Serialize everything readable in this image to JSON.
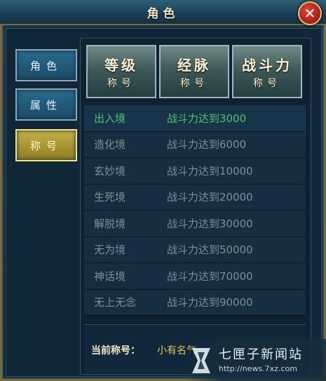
{
  "window": {
    "title": "角色",
    "close_label": "✕"
  },
  "side_tabs": [
    {
      "label": "角色"
    },
    {
      "label": "属性"
    },
    {
      "label": "称号",
      "active": true
    }
  ],
  "categories": [
    {
      "big": "等级",
      "small": "称号"
    },
    {
      "big": "经脉",
      "small": "称号"
    },
    {
      "big": "战斗力",
      "small": "称号"
    }
  ],
  "titles": [
    {
      "name": "出入境",
      "requirement": "战斗力达到3000",
      "highlight": true
    },
    {
      "name": "造化境",
      "requirement": "战斗力达到6000"
    },
    {
      "name": "玄妙境",
      "requirement": "战斗力达到10000"
    },
    {
      "name": "生死境",
      "requirement": "战斗力达到20000"
    },
    {
      "name": "解脱境",
      "requirement": "战斗力达到30000"
    },
    {
      "name": "无为境",
      "requirement": "战斗力达到50000"
    },
    {
      "name": "神话境",
      "requirement": "战斗力达到70000"
    },
    {
      "name": "无上无念",
      "requirement": "战斗力达到90000"
    }
  ],
  "current": {
    "label": "当前称号：",
    "value": "小有名气"
  },
  "watermark": {
    "name": "七匣子新闻站",
    "url": "http://news.7xz.com"
  },
  "colors": {
    "highlight": "#4ec26b",
    "gold_tab": "#c6b24a"
  }
}
